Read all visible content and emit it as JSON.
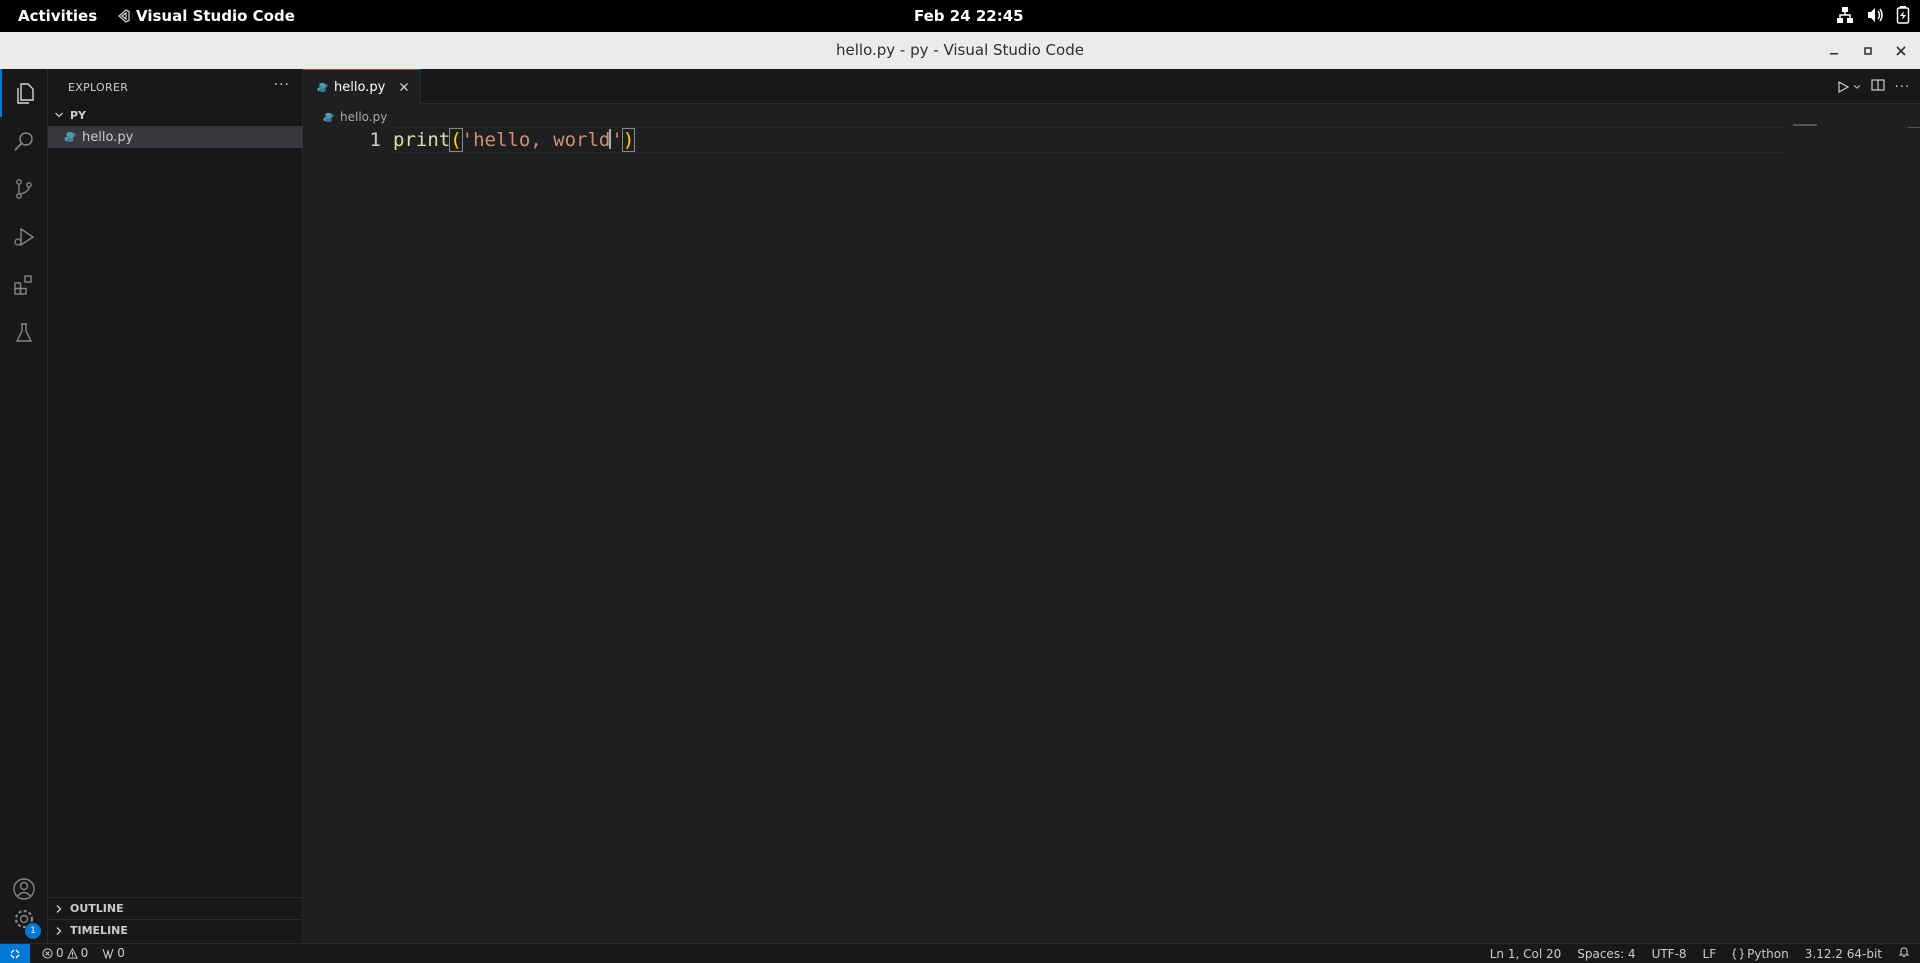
{
  "topbar": {
    "activities": "Activities",
    "app_name": "Visual Studio Code",
    "clock": "Feb 24  22:45"
  },
  "window": {
    "title": "hello.py - py - Visual Studio Code"
  },
  "activity_bar": {
    "items": [
      "explorer-icon",
      "search-icon",
      "source-control-icon",
      "run-debug-icon",
      "extensions-icon",
      "testing-icon"
    ],
    "bottom": [
      "accounts-icon",
      "manage-gear-icon"
    ],
    "manage_badge": "1"
  },
  "sidebar": {
    "header": "EXPLORER",
    "folder": "PY",
    "files": [
      {
        "name": "hello.py"
      }
    ],
    "outline": "OUTLINE",
    "timeline": "TIMELINE"
  },
  "editor": {
    "tab_label": "hello.py",
    "breadcrumb": "hello.py",
    "line_number": "1",
    "code": {
      "fn": "print",
      "open": "(",
      "str_before_cursor": "'hello, world",
      "str_after_cursor": "'",
      "close": ")"
    }
  },
  "statusbar": {
    "errors": "0",
    "warnings": "0",
    "ports": "0",
    "position": "Ln 1, Col 20",
    "spaces": "Spaces: 4",
    "encoding": "UTF-8",
    "eol": "LF",
    "language": "Python",
    "interpreter": "3.12.2 64-bit"
  },
  "colors": {
    "accent": "#0078d4",
    "function": "#dcdcaa",
    "string": "#ce9178",
    "bracket": "#ffd700"
  }
}
